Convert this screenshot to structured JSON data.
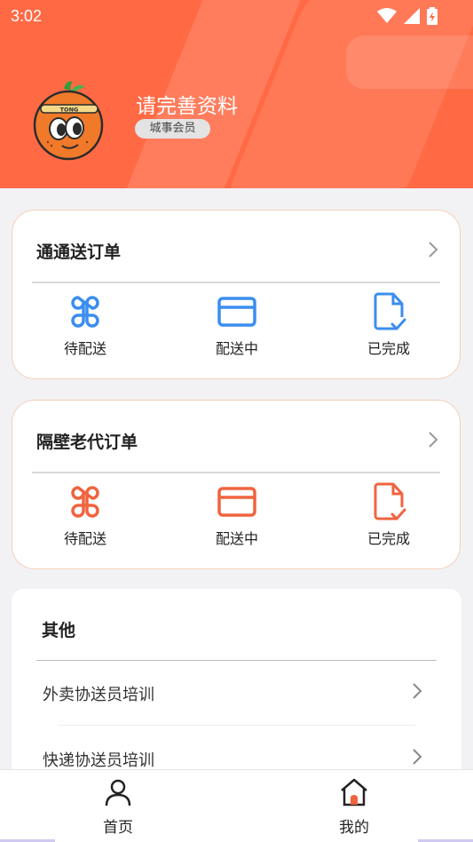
{
  "status_bar": {
    "time": "3:02"
  },
  "profile": {
    "name": "请完善资料",
    "badge": "城事会员",
    "avatar_mark": "TONG"
  },
  "cards": [
    {
      "title": "通通送订单",
      "accent": "#3b8ef0",
      "items": [
        {
          "label": "待配送",
          "icon": "command-icon"
        },
        {
          "label": "配送中",
          "icon": "card-icon"
        },
        {
          "label": "已完成",
          "icon": "document-check-icon"
        }
      ]
    },
    {
      "title": "隔壁老代订单",
      "accent": "#f0643f",
      "items": [
        {
          "label": "待配送",
          "icon": "command-icon"
        },
        {
          "label": "配送中",
          "icon": "card-icon"
        },
        {
          "label": "已完成",
          "icon": "document-check-icon"
        }
      ]
    }
  ],
  "other": {
    "title": "其他",
    "rows": [
      {
        "label": "外卖协送员培训"
      },
      {
        "label": "快递协送员培训"
      }
    ]
  },
  "tabbar": {
    "tabs": [
      {
        "label": "首页",
        "icon": "person-icon"
      },
      {
        "label": "我的",
        "icon": "house-icon"
      }
    ]
  },
  "colors": {
    "header": "#ff6a45",
    "blue": "#3b8ef0",
    "orange": "#f0643f"
  }
}
